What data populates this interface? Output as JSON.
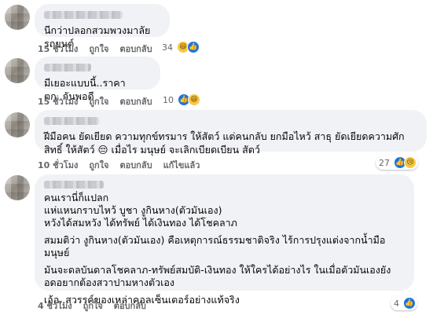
{
  "comments": [
    {
      "text": "นีกว่าปลอกสวมพวงมาลัยรถยนต์",
      "time": "15 ชั่วโมง",
      "like": "ถูกใจ",
      "reply": "ตอบกลับ",
      "reaction_count": "34"
    },
    {
      "text": "มีเยอะแบบนี้..ราคาตก..กันพอดี",
      "time": "15 ชั่วโมง",
      "like": "ถูกใจ",
      "reply": "ตอบกลับ",
      "reaction_count": "10"
    },
    {
      "text": "ฝีมือคน ยัดเยียด ความทุกข์ทรมาร ให้สัตว์ แต่คนกลับ ยกมือไหว้ สาธุ ยัดเยียดความศักสิทธิ์ ให้สัตว์ 😔 เมื่อไร มนุษย์ จะเลิกเบียดเบียน สัตว์",
      "time": "10 ชั่วโมง",
      "like": "ถูกใจ",
      "reply": "ตอบกลับ",
      "edited": "แก้ไขแล้ว",
      "reaction_count": "27"
    },
    {
      "paragraphs": [
        "คนเรานี่ก็แปลก\nแห่แหนกราบไหว้ บูชา งูกินหาง(ตัวมันเอง)\nหวังได้สมหวัง ได้ทรัพย์ ได้เงินทอง ได้โชคลาภ",
        "สมมติว่า งูกินหาง(ตัวมันเอง) คือเหตุการณ์ธรรมชาติจริง ไร้การปรุงแต่งจากน้ำมือมนุษย์",
        "มันจะดลบันดาลโชคลาภ-ทรัพย์สมบัติ-เงินทอง ให้ใครได้อย่างไร ในเมื่อตัวมันเองยังอดอยากต้องสวาปามหางตัวเอง",
        "เอ้อ..สวรรค์ของเหล่าคอลเซ็นเตอร์อย่างแท้จริง"
      ],
      "time": "4 ชั่วโมง",
      "like": "ถูกใจ",
      "reply": "ตอบกลับ",
      "reaction_count": "4"
    }
  ],
  "icons": {
    "like": "thumbs-up-icon",
    "haha": "haha-emoji-icon",
    "sad": "sad-emoji-icon"
  },
  "colors": {
    "bubble": "#f0f2f5",
    "meta_text": "#65676b",
    "like_blue": "#1b74e4"
  }
}
